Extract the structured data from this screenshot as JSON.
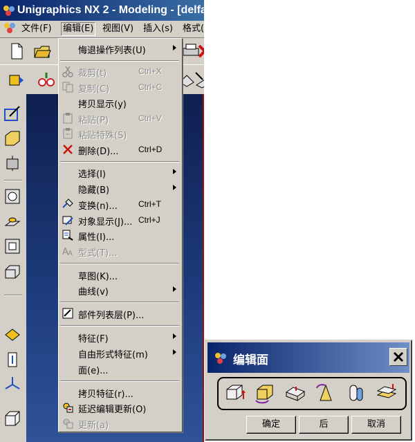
{
  "window": {
    "title": "Unigraphics NX 2 - Modeling - [delfa"
  },
  "menubar": {
    "items": [
      "文件(F)",
      "编辑(E)",
      "视图(V)",
      "插入(s)",
      "格式("
    ]
  },
  "edit_menu": {
    "items": [
      {
        "label": "悔退操作列表(U)",
        "submenu": true
      },
      {
        "label": "裁剪(t)",
        "shortcut": "Ctrl+X",
        "disabled": true
      },
      {
        "label": "复制(C)",
        "shortcut": "Ctrl+C",
        "disabled": true
      },
      {
        "label": "拷贝显示(y)"
      },
      {
        "label": "粘贴(P)",
        "shortcut": "Ctrl+V",
        "disabled": true
      },
      {
        "label": "粘贴特殊(S)",
        "disabled": true
      },
      {
        "label": "删除(D)...",
        "shortcut": "Ctrl+D"
      },
      {
        "label": "选择(I)",
        "submenu": true
      },
      {
        "label": "隐藏(B)",
        "submenu": true
      },
      {
        "label": "变换(n)...",
        "shortcut": "Ctrl+T"
      },
      {
        "label": "对象显示(J)...",
        "shortcut": "Ctrl+J"
      },
      {
        "label": "属性(I)..."
      },
      {
        "label": "型式(T)...",
        "disabled": true
      },
      {
        "label": "草图(K)..."
      },
      {
        "label": "曲线(v)",
        "submenu": true
      },
      {
        "label": "部件列表层(P)..."
      },
      {
        "label": "特征(F)",
        "submenu": true
      },
      {
        "label": "自由形式特征(m)",
        "submenu": true
      },
      {
        "label": "面(e)..."
      },
      {
        "label": "拷贝特征(r)..."
      },
      {
        "label": "延迟编辑更新(O)"
      },
      {
        "label": "更新(a)",
        "disabled": true
      }
    ]
  },
  "dialog": {
    "title": "编辑面",
    "buttons": {
      "ok": "确定",
      "back": "后",
      "cancel": "取消"
    }
  },
  "colors": {
    "title_bar": "#0a246a",
    "menu_face": "#d4d0c8",
    "canvas": "#1c3b7a",
    "disabled_text": "#8c8c8c"
  }
}
